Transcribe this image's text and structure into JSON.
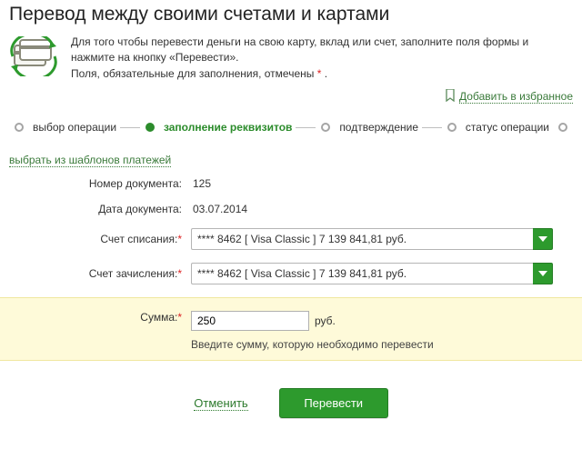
{
  "title": "Перевод между своими счетами и картами",
  "intro": {
    "line1": "Для того чтобы перевести деньги на свою карту, вклад или счет, заполните поля формы и нажмите на кнопку «Перевести».",
    "line2_a": "Поля, обязательные для заполнения, отмечены ",
    "line2_b": "*",
    "line2_c": " ."
  },
  "favorites_label": "Добавить в избранное",
  "wizard": {
    "steps": [
      {
        "label": "выбор операции",
        "active": false
      },
      {
        "label": "заполнение реквизитов",
        "active": true
      },
      {
        "label": "подтверждение",
        "active": false
      },
      {
        "label": "статус операции",
        "active": false
      }
    ]
  },
  "template_link": "выбрать из шаблонов платежей",
  "fields": {
    "doc_number_label": "Номер документа:",
    "doc_number_value": "125",
    "doc_date_label": "Дата документа:",
    "doc_date_value": "03.07.2014",
    "debit_label": "Счет списания:",
    "debit_value": "**** 8462  [ Visa Classic ] 7 139 841,81   руб.",
    "credit_label": "Счет зачисления:",
    "credit_value": "**** 8462  [ Visa Classic ] 7 139 841,81   руб.",
    "amount_label": "Сумма:",
    "amount_value": "250",
    "amount_currency": "руб.",
    "amount_hint": "Введите сумму, которую необходимо перевести",
    "star": "*"
  },
  "actions": {
    "cancel": "Отменить",
    "submit": "Перевести"
  }
}
